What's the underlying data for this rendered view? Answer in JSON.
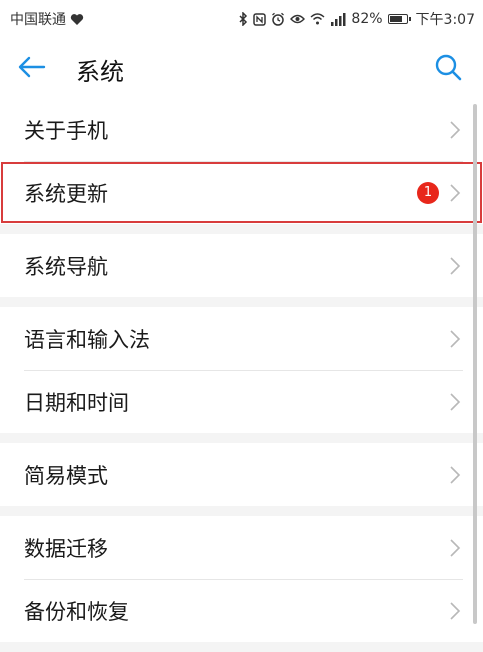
{
  "status_bar": {
    "carrier": "中国联通",
    "battery_level": 0.82,
    "battery": "82%",
    "time": "下午3:07",
    "icons": [
      "heart-icon",
      "bluetooth-icon",
      "nfc-icon",
      "alarm-icon",
      "eye-icon",
      "wifi-icon",
      "signal-icon",
      "battery-icon"
    ]
  },
  "app_bar": {
    "title": "系统",
    "back_icon": "back-arrow-icon",
    "search_icon": "search-icon"
  },
  "sections": [
    {
      "items": [
        {
          "label": "关于手机"
        },
        {
          "label": "系统更新",
          "badge": "1",
          "highlighted": true
        }
      ]
    },
    {
      "items": [
        {
          "label": "系统导航"
        }
      ]
    },
    {
      "items": [
        {
          "label": "语言和输入法"
        },
        {
          "label": "日期和时间"
        }
      ]
    },
    {
      "items": [
        {
          "label": "简易模式"
        }
      ]
    },
    {
      "items": [
        {
          "label": "数据迁移"
        },
        {
          "label": "备份和恢复"
        }
      ]
    }
  ],
  "colors": {
    "accent": "#1c8fe3",
    "badge": "#e8271b",
    "highlight_box": "#d83c3c"
  }
}
